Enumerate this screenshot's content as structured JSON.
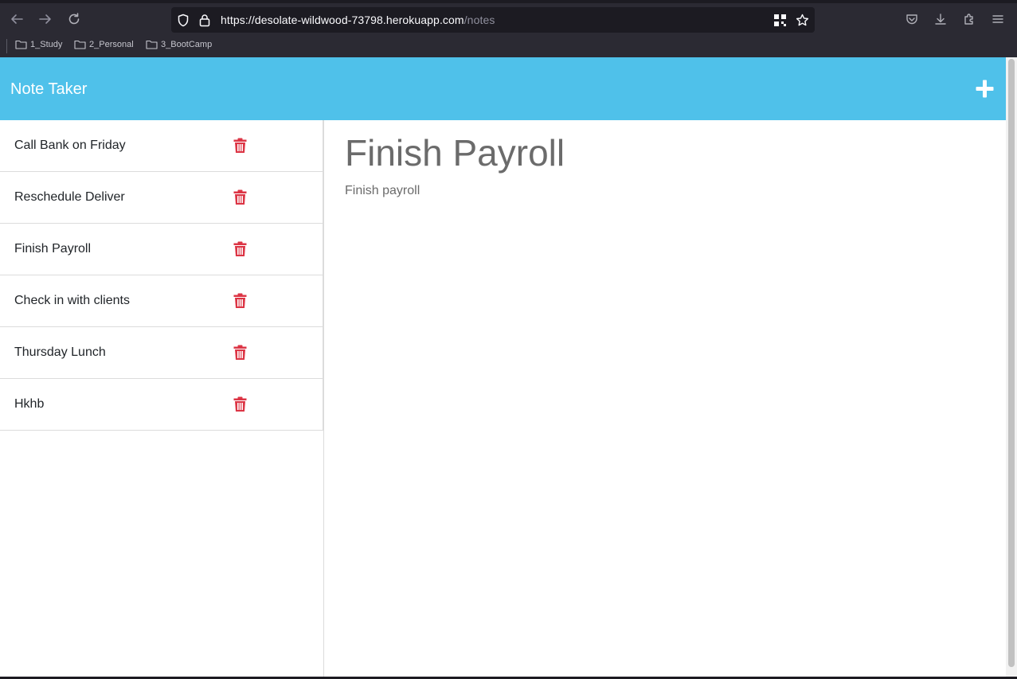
{
  "browser": {
    "url_main": "https://desolate-wildwood-73798.herokuapp.com",
    "url_path": "/notes",
    "bookmarks": [
      "1_Study",
      "2_Personal",
      "3_BootCamp"
    ]
  },
  "app": {
    "brand": "Note Taker",
    "header_color": "#4fc1ea",
    "delete_color": "#dc3545"
  },
  "notes": [
    {
      "title": "Call Bank on Friday"
    },
    {
      "title": "Reschedule Deliver"
    },
    {
      "title": "Finish Payroll"
    },
    {
      "title": "Check in with clients"
    },
    {
      "title": "Thursday Lunch"
    },
    {
      "title": "Hkhb"
    }
  ],
  "active_note": {
    "title": "Finish Payroll",
    "text": "Finish payroll"
  },
  "icons": {
    "add": "plus-icon",
    "delete": "trash-icon"
  }
}
